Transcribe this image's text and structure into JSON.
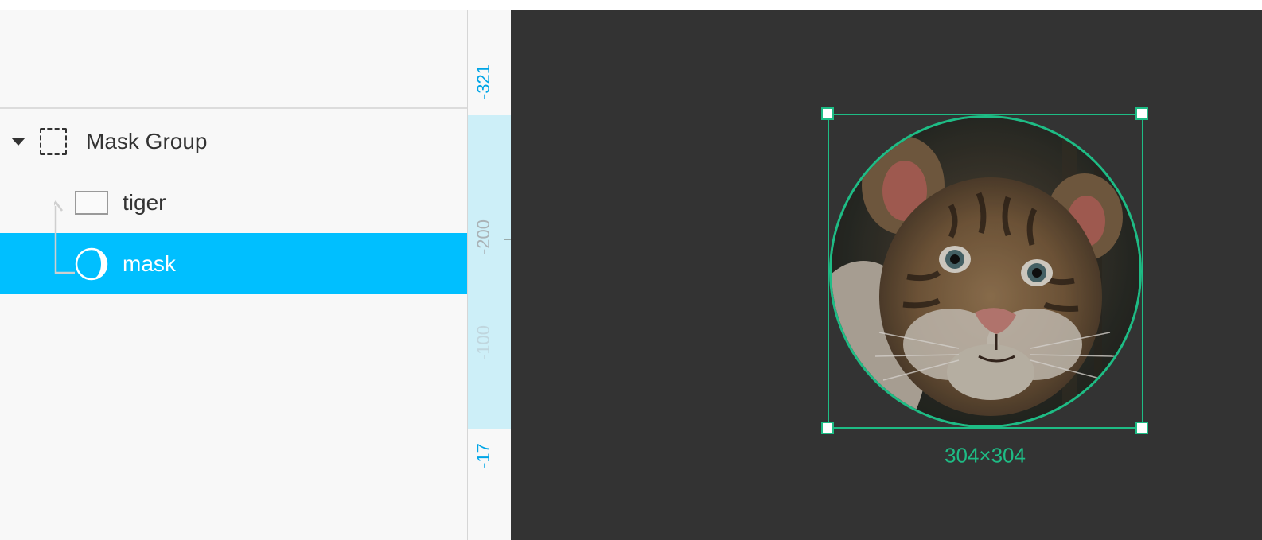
{
  "layers": {
    "items": [
      {
        "label": "Mask Group",
        "icon": "mask-group-icon"
      },
      {
        "label": "tiger",
        "icon": "rectangle-icon"
      },
      {
        "label": "mask",
        "icon": "mask-icon",
        "selected": true
      }
    ]
  },
  "ruler": {
    "labels": [
      "-321",
      "-200",
      "-100",
      "-17"
    ]
  },
  "canvas": {
    "selection_dimensions": "304×304"
  },
  "colors": {
    "accent": "#00bfff",
    "selection": "#1ebc85",
    "canvas_bg": "#333333",
    "panel_bg": "#f8f8f8"
  }
}
